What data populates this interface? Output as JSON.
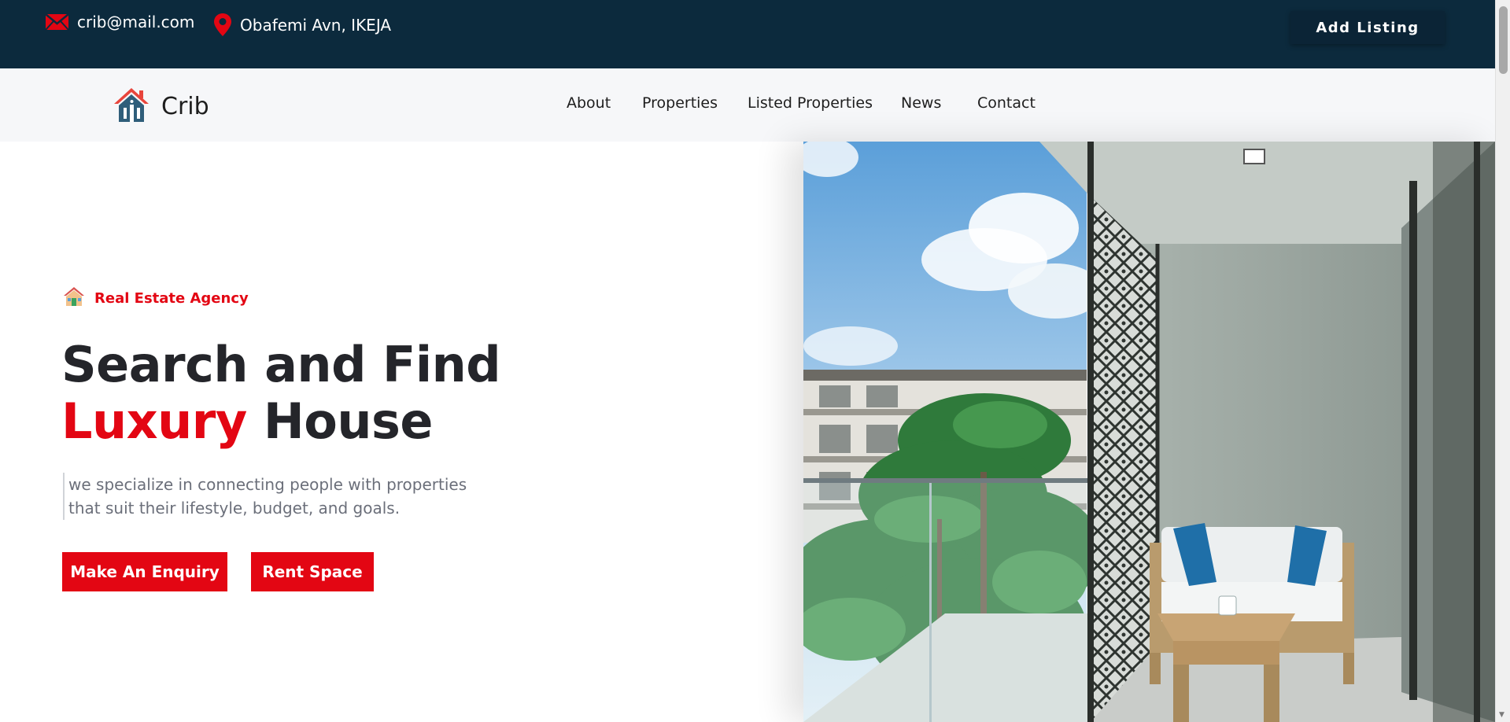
{
  "topbar": {
    "email": "crib@mail.com",
    "address": "Obafemi Avn, IKEJA",
    "add_listing_label": "Add Listing",
    "email_icon": "mail-icon",
    "address_icon": "map-pin-icon"
  },
  "nav": {
    "brand": "Crib",
    "logo_icon": "house-icon",
    "items": [
      {
        "label": "About"
      },
      {
        "label": "Properties"
      },
      {
        "label": "Listed Properties"
      },
      {
        "label": "News"
      },
      {
        "label": "Contact"
      }
    ]
  },
  "hero": {
    "tagline": "Real Estate Agency",
    "tagline_icon": "house-emoji-icon",
    "headline_line1": "Search and Find",
    "headline_accent": "Luxury",
    "headline_rest": " House",
    "description": "we specialize in connecting people with properties that suit their lifestyle, budget, and goals.",
    "buttons": {
      "enquiry": "Make An Enquiry",
      "rent": "Rent Space"
    },
    "image_icon": "balcony-photo"
  },
  "colors": {
    "topbar_bg": "#0c2a3d",
    "accent": "#e30613",
    "nav_bg": "#f6f7f9",
    "heading": "#24252a"
  }
}
